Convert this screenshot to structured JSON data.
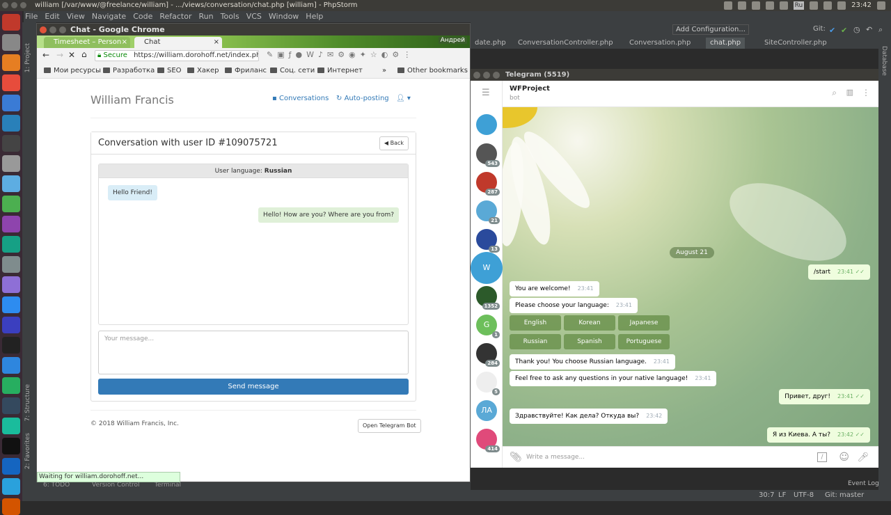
{
  "os": {
    "window_title": "william [/var/www/@freelance/william] - .../views/conversation/chat.php [william] - PhpStorm",
    "clock": "23:42",
    "keyboard_layout": "Ru"
  },
  "ide": {
    "menu": [
      "File",
      "Edit",
      "View",
      "Navigate",
      "Code",
      "Refactor",
      "Run",
      "Tools",
      "VCS",
      "Window",
      "Help"
    ],
    "add_config": "Add Configuration...",
    "git_label": "Git:",
    "tabs": [
      "date.php",
      "ConversationController.php",
      "Conversation.php",
      "chat.php",
      "SiteController.php"
    ],
    "side_left": [
      "1: Project",
      "7: Structure",
      "2: Favorites"
    ],
    "side_right": "Database",
    "bottom_tabs": [
      "6: TODO",
      "Version Control",
      "Terminal"
    ],
    "status": {
      "pos": "30:7",
      "lf": "LF",
      "enc": "UTF-8",
      "git": "Git: master",
      "event_log": "Event Log"
    }
  },
  "chrome": {
    "title": "Chat - Google Chrome",
    "profile": "Андрей",
    "tabs": [
      {
        "label": "Timesheet – Person"
      },
      {
        "label": "Chat"
      }
    ],
    "secure": "Secure",
    "url": "https://william.dorohoff.net/index.php?...",
    "bookmarks": [
      "Мои ресурсы",
      "Разработка",
      "SEO",
      "Хакер",
      "Фриланс",
      "Соц. сети",
      "Интернет"
    ],
    "other_bookmarks": "Other bookmarks",
    "more": "»",
    "status": "Waiting for william.dorohoff.net..."
  },
  "site": {
    "brand": "William Francis",
    "nav_conversations": "Conversations",
    "nav_autoposting": "Auto-posting",
    "conversation_title": "Conversation with user ID #109075721",
    "back": "Back",
    "lang_label": "User language:",
    "lang_value": "Russian",
    "msg_in": "Hello Friend!",
    "msg_out": "Hello! How are you? Where are you from?",
    "placeholder": "Your message...",
    "send": "Send message",
    "footer": "© 2018 William Francis, Inc.",
    "open_tg": "Open Telegram Bot"
  },
  "telegram": {
    "title": "Telegram (5519)",
    "chat_name": "WFProject",
    "chat_sub": "bot",
    "date": "August 21",
    "sidebar": [
      {
        "label": "",
        "badge": "",
        "color": "#3ea0d6"
      },
      {
        "label": "",
        "badge": "543",
        "color": "#555"
      },
      {
        "label": "",
        "badge": "287",
        "color": "#c0392b"
      },
      {
        "label": "",
        "badge": "21",
        "color": "#5aa9d6"
      },
      {
        "label": "",
        "badge": "13",
        "color": "#2a4a9c"
      },
      {
        "label": "W",
        "badge": "",
        "color": "#3ea0d6"
      },
      {
        "label": "",
        "badge": "1352",
        "color": "#2c5a2a"
      },
      {
        "label": "G",
        "badge": "1",
        "color": "#6dbf5b"
      },
      {
        "label": "",
        "badge": "284",
        "color": "#333"
      },
      {
        "label": "",
        "badge": "5",
        "color": "#eee"
      },
      {
        "label": "ЛА",
        "badge": "",
        "color": "#5aa9d6"
      },
      {
        "label": "",
        "badge": "414",
        "color": "#e04a7a"
      },
      {
        "label": "",
        "badge": "",
        "color": "#999"
      }
    ],
    "messages": [
      {
        "text": "/start",
        "time": "23:41",
        "out": true
      },
      {
        "text": "You are welcome!",
        "time": "23:41",
        "out": false
      },
      {
        "text": "Please choose your language:",
        "time": "23:41",
        "out": false
      },
      {
        "text": "Thank you! You choose Russian language.",
        "time": "23:41",
        "out": false
      },
      {
        "text": "Feel free to ask any questions in your native language!",
        "time": "23:41",
        "out": false
      },
      {
        "text": "Привет, друг!",
        "time": "23:41",
        "out": true
      },
      {
        "text": "Здравствуйте! Как дела? Откуда вы?",
        "time": "23:42",
        "out": false
      },
      {
        "text": "Я из Киева. А ты?",
        "time": "23:42",
        "out": true
      }
    ],
    "keyboard": [
      "English",
      "Korean",
      "Japanese",
      "Russian",
      "Spanish",
      "Portuguese"
    ],
    "input_placeholder": "Write a message..."
  }
}
